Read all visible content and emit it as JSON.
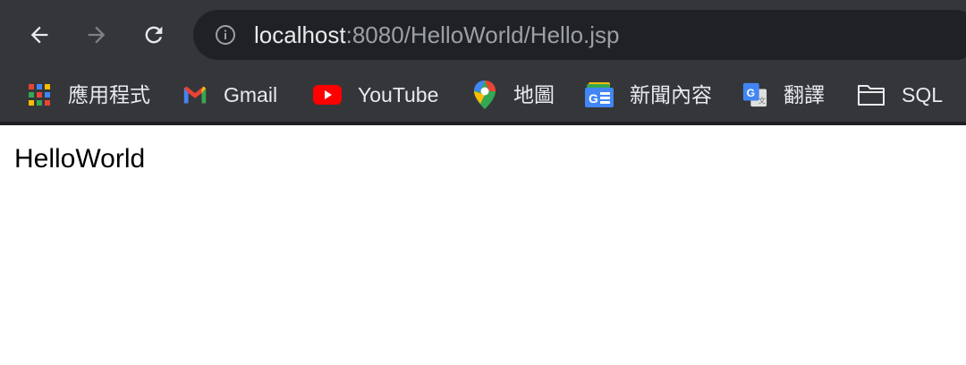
{
  "url": {
    "host": "localhost",
    "rest": ":8080/HelloWorld/Hello.jsp"
  },
  "bookmarks": [
    {
      "label": "應用程式",
      "icon": "apps-grid-icon"
    },
    {
      "label": "Gmail",
      "icon": "gmail-icon"
    },
    {
      "label": "YouTube",
      "icon": "youtube-icon"
    },
    {
      "label": "地圖",
      "icon": "maps-pin-icon"
    },
    {
      "label": "新聞內容",
      "icon": "google-news-icon"
    },
    {
      "label": "翻譯",
      "icon": "google-translate-icon"
    },
    {
      "label": "SQL",
      "icon": "folder-icon"
    }
  ],
  "page": {
    "text": "HelloWorld"
  },
  "colors": {
    "toolbar_bg": "#35363a",
    "omnibox_bg": "#202124",
    "text_light": "#e8eaed",
    "text_dim": "#9aa0a6"
  }
}
